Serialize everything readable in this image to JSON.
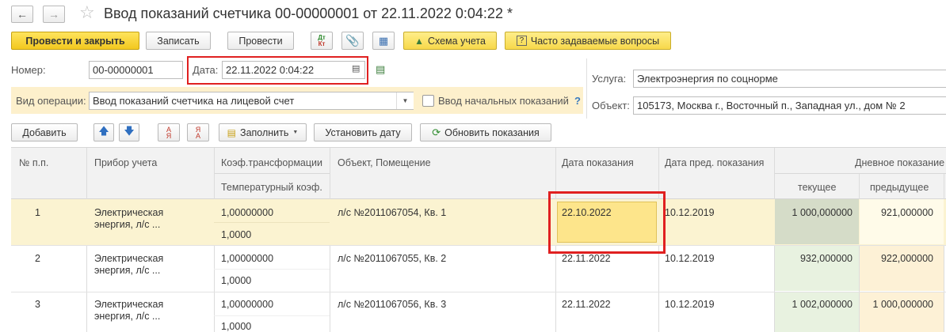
{
  "window": {
    "title": "Ввод показаний счетчика 00-00000001 от 22.11.2022 0:04:22 *"
  },
  "toolbar": {
    "post_close": "Провести и закрыть",
    "write": "Записать",
    "post": "Провести",
    "dtkt_top": "Дт",
    "dtkt_bottom": "Кт",
    "scheme": "Схема учета",
    "faq": "Часто задаваемые вопросы"
  },
  "form": {
    "number_label": "Номер:",
    "number_value": "00-00000001",
    "date_label": "Дата:",
    "date_value": "22.11.2022  0:04:22",
    "operation_label": "Вид операции:",
    "operation_value": "Ввод показаний счетчика на лицевой счет",
    "initial_label": "Ввод начальных показаний",
    "help_mark": "?",
    "service_label": "Услуга:",
    "service_value": "Электроэнергия по соцнорме",
    "object_label": "Объект:",
    "object_value": "105173, Москва г., Восточный п., Западная ул., дом № 2"
  },
  "table_toolbar": {
    "add": "Добавить",
    "fill": "Заполнить",
    "set_date": "Установить дату",
    "refresh": "Обновить показания"
  },
  "table": {
    "headers": {
      "num": "№ п.п.",
      "device": "Прибор учета",
      "coef": "Коэф.трансформации",
      "temp": "Температурный коэф.",
      "object": "Объект, Помещение",
      "date": "Дата показания",
      "prev_date": "Дата пред. показания",
      "day": "Дневное показание",
      "current": "текущее",
      "previous": "предыдущее"
    },
    "rows": [
      {
        "num": "1",
        "device": "Электрическая энергия, л/с ...",
        "coef": "1,00000000",
        "temp": "1,0000",
        "object": "л/с №2011067054, Кв. 1",
        "date": "22.10.2022",
        "prev_date": "10.12.2019",
        "current": "1 000,000000",
        "previous": "921,000000"
      },
      {
        "num": "2",
        "device": "Электрическая энергия, л/с ...",
        "coef": "1,00000000",
        "temp": "1,0000",
        "object": "л/с №2011067055, Кв. 2",
        "date": "22.11.2022",
        "prev_date": "10.12.2019",
        "current": "932,000000",
        "previous": "922,000000"
      },
      {
        "num": "3",
        "device": "Электрическая энергия, л/с ...",
        "coef": "1,00000000",
        "temp": "1,0000",
        "object": "л/с №2011067056, Кв. 3",
        "date": "22.11.2022",
        "prev_date": "10.12.2019",
        "current": "1 002,000000",
        "previous": "1 000,000000"
      }
    ]
  },
  "colors": {
    "highlight_red": "#e02020",
    "selected_row": "#fbf3d1",
    "edit_cell": "#fde58b",
    "current_col": "#e8f2e0",
    "previous_col": "#fdf1d6",
    "operation_band": "#fdf0cc"
  }
}
